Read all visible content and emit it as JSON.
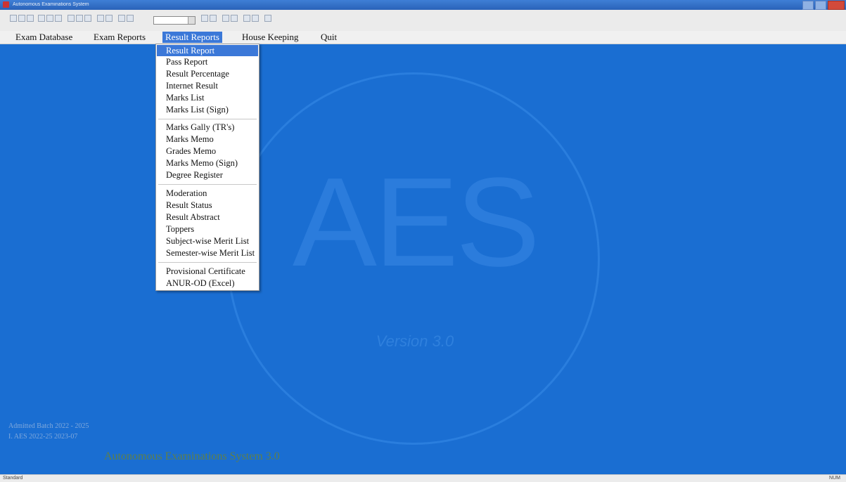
{
  "window": {
    "title": "Autonomous Examinations System"
  },
  "menubar": {
    "items": [
      "Exam Database",
      "Exam Reports",
      "Result Reports",
      "House Keeping",
      "Quit"
    ],
    "active_index": 2
  },
  "dropdown": {
    "items": [
      "Result Report",
      "Pass Report",
      "Result Percentage",
      "Internet Result",
      "Marks List",
      "Marks List (Sign)",
      "Marks Gally (TR's)",
      "Marks Memo",
      "Grades Memo",
      "Marks Memo (Sign)",
      "Degree Register",
      "Moderation",
      "Result Status",
      "Result Abstract",
      "Toppers",
      "Subject-wise Merit List",
      "Semester-wise Merit List",
      "Provisional Certificate",
      "ANUR-OD (Excel)"
    ],
    "highlighted_index": 0
  },
  "watermark": {
    "text": "AES",
    "subtitle": "Version 3.0"
  },
  "desktop": {
    "batch_line1": "Admitted Batch 2022 - 2025",
    "batch_line2": "I. AES 2022-25 2023-07",
    "footer": "Autonomous Examinations System 3.0"
  },
  "statusbar": {
    "left": "Standard",
    "right": "NUM"
  },
  "colors": {
    "desktop": "#1a6ed2",
    "highlight": "#3b78d8",
    "menubar": "#f0f0f0"
  }
}
